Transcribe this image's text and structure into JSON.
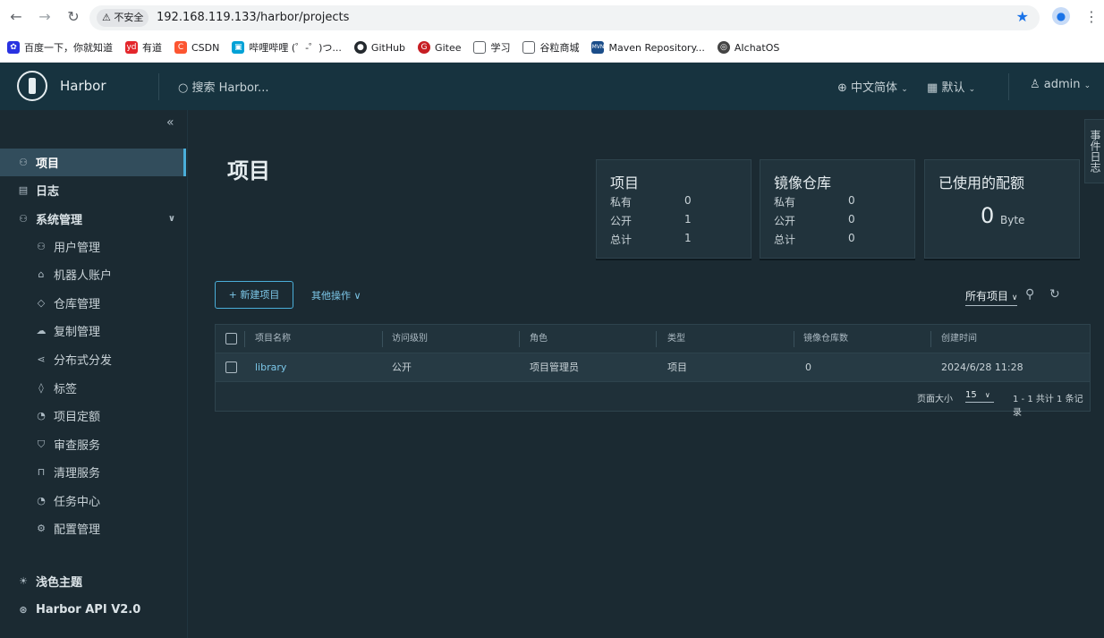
{
  "browser": {
    "insecure_label": "不安全",
    "url": "192.168.119.133/harbor/projects",
    "bookmarks": [
      "百度一下，你就知道",
      "有道",
      "CSDN",
      "哔哩哔哩 (゜-゜)つ...",
      "GitHub",
      "Gitee",
      "学习",
      "谷粒商城",
      "Maven Repository...",
      "AIchatOS"
    ]
  },
  "header": {
    "brand": "Harbor",
    "search_placeholder": "搜索 Harbor...",
    "language": "中文简体",
    "datetime_format": "默认",
    "user": "admin"
  },
  "sidebar": {
    "items": [
      {
        "label": "项目"
      },
      {
        "label": "日志"
      },
      {
        "label": "系统管理"
      }
    ],
    "sub_items": [
      "用户管理",
      "机器人账户",
      "仓库管理",
      "复制管理",
      "分布式分发",
      "标签",
      "项目定额",
      "审查服务",
      "清理服务",
      "任务中心",
      "配置管理"
    ],
    "theme": "浅色主题",
    "api": "Harbor API V2.0"
  },
  "main": {
    "title": "项目",
    "event_log_tab": "事件日志",
    "cards": {
      "projects": {
        "title": "项目",
        "private_label": "私有",
        "private": "0",
        "public_label": "公开",
        "public": "1",
        "total_label": "总计",
        "total": "1"
      },
      "repos": {
        "title": "镜像仓库",
        "private_label": "私有",
        "private": "0",
        "public_label": "公开",
        "public": "0",
        "total_label": "总计",
        "total": "0"
      },
      "quota": {
        "title": "已使用的配额",
        "value": "0",
        "unit": "Byte"
      }
    },
    "new_project": "+ 新建项目",
    "more_actions": "其他操作",
    "filter": "所有项目",
    "table": {
      "headers": [
        "项目名称",
        "访问级别",
        "角色",
        "类型",
        "镜像仓库数",
        "创建时间"
      ],
      "rows": [
        {
          "name": "library",
          "access": "公开",
          "role": "项目管理员",
          "type": "项目",
          "repo_count": "0",
          "created": "2024/6/28 11:28"
        }
      ],
      "page_size_label": "页面大小",
      "page_size": "15",
      "summary": "1 - 1 共计 1 条记录"
    }
  }
}
